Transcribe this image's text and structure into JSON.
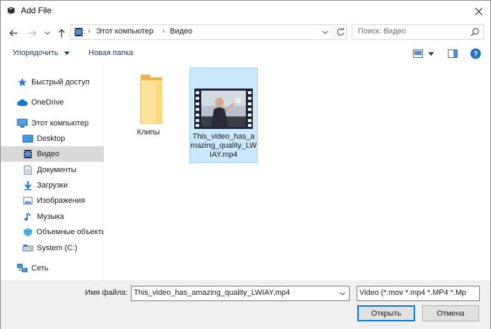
{
  "window": {
    "title": "Add File"
  },
  "address": {
    "crumbs": [
      "Этот компьютер",
      "Видео"
    ]
  },
  "search": {
    "placeholder": "Поиск: Видео"
  },
  "toolbar": {
    "organize_label": "Упорядочить",
    "new_folder_label": "Новая папка"
  },
  "sidebar": {
    "items": [
      {
        "label": "Быстрый доступ",
        "icon": "star-icon"
      },
      {
        "label": "OneDrive",
        "icon": "cloud-icon"
      },
      {
        "label": "Этот компьютер",
        "icon": "computer-icon"
      },
      {
        "label": "Desktop",
        "icon": "desktop-icon"
      },
      {
        "label": "Видео",
        "icon": "video-folder-icon",
        "selected": true
      },
      {
        "label": "Документы",
        "icon": "documents-icon"
      },
      {
        "label": "Загрузки",
        "icon": "downloads-icon"
      },
      {
        "label": "Изображения",
        "icon": "pictures-icon"
      },
      {
        "label": "Музыка",
        "icon": "music-icon"
      },
      {
        "label": "Объемные объекты",
        "icon": "3d-objects-icon"
      },
      {
        "label": "System (C:)",
        "icon": "drive-icon"
      },
      {
        "label": "Сеть",
        "icon": "network-icon"
      }
    ]
  },
  "files": [
    {
      "name": "Клипы",
      "type": "folder"
    },
    {
      "name": "This_video_has_amazing_quality_LWIAY.mp4",
      "type": "video",
      "selected": true
    }
  ],
  "footer": {
    "filename_label": "Имя файла:",
    "filename_value": "This_video_has_amazing_quality_LWIAY.mp4",
    "filter_value": "Video (*.mov *.mp4 *.MP4 *.Mp",
    "open_label": "Открыть",
    "cancel_label": "Отмена"
  },
  "colors": {
    "selection": "#cce8ff",
    "selection_border": "#99d1ff",
    "accent": "#0078d7",
    "folder": "#f8d775"
  }
}
